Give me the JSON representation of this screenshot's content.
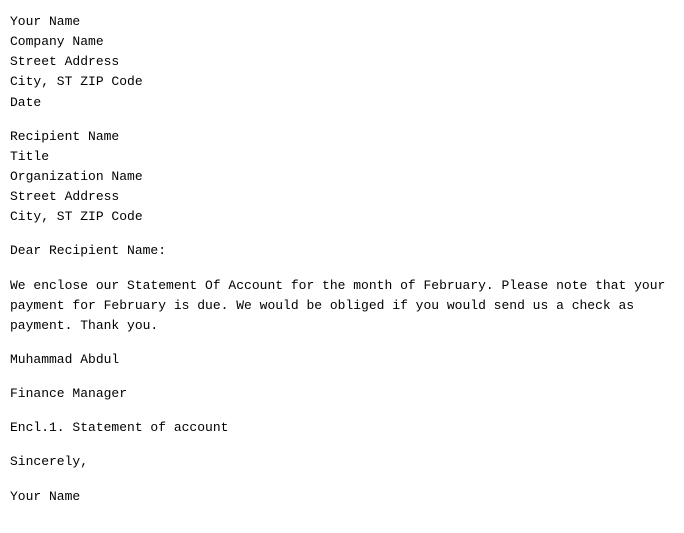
{
  "sender": {
    "name": "Your Name",
    "company": "Company Name",
    "street": "Street Address",
    "city": "City, ST ZIP Code",
    "date": "Date"
  },
  "recipient": {
    "name": "Recipient Name",
    "title": "Title",
    "organization": "Organization Name",
    "street": "Street Address",
    "city": "City, ST ZIP Code"
  },
  "salutation": "Dear Recipient Name:",
  "body": "We enclose our Statement Of Account for the month of February. Please note that your\npayment for February is due. We would be obliged if you would send us a check as\npayment. Thank you.",
  "signature_name": "Muhammad Abdul",
  "signature_title": "Finance Manager",
  "enclosure": "Encl.1. Statement of account",
  "closing": "Sincerely,",
  "closing_name": "Your Name"
}
